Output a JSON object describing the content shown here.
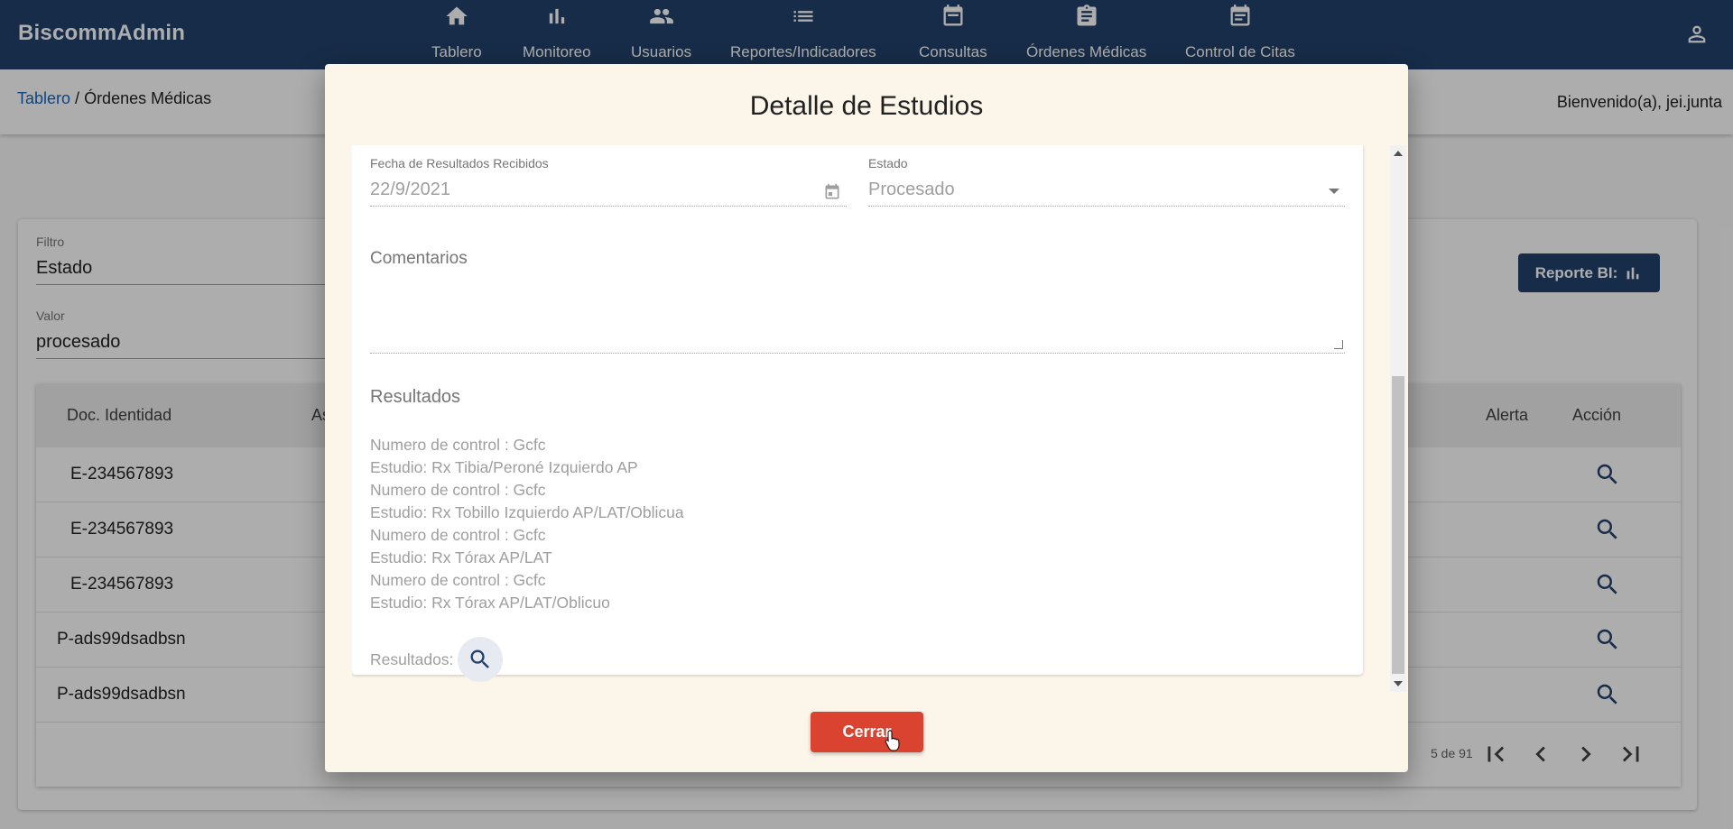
{
  "app": {
    "brand": "BiscommAdmin"
  },
  "nav": {
    "items": [
      {
        "label": "Tablero",
        "icon": "home-icon"
      },
      {
        "label": "Monitoreo",
        "icon": "bar-chart-icon"
      },
      {
        "label": "Usuarios",
        "icon": "people-icon"
      },
      {
        "label": "Reportes/Indicadores",
        "icon": "list-icon"
      },
      {
        "label": "Consultas",
        "icon": "calendar-icon"
      },
      {
        "label": "Órdenes Médicas",
        "icon": "clipboard-icon"
      },
      {
        "label": "Control de Citas",
        "icon": "calendar-icon"
      }
    ],
    "user_icon": "account-icon"
  },
  "breadcrumb": {
    "link": "Tablero",
    "separator": " / ",
    "current": "Órdenes Médicas"
  },
  "welcome": "Bienvenido(a), jei.junta",
  "filters": {
    "filter_label": "Filtro",
    "filter_value": "Estado",
    "value_label": "Valor",
    "value_value": "procesado"
  },
  "bi_button": {
    "label": "Reporte BI:",
    "icon": "bar-chart-icon"
  },
  "table": {
    "columns": [
      "Doc. Identidad",
      "As",
      "Alerta",
      "Acción"
    ],
    "rows": [
      {
        "doc": "E-234567893"
      },
      {
        "doc": "E-234567893"
      },
      {
        "doc": "E-234567893"
      },
      {
        "doc": "P-ads99dsadbsn"
      },
      {
        "doc": "P-ads99dsadbsn"
      }
    ],
    "range": "5 de 91"
  },
  "dialog": {
    "title": "Detalle de Estudios",
    "date_label": "Fecha de Resultados Recibidos",
    "date_value": "22/9/2021",
    "status_label": "Estado",
    "status_value": "Procesado",
    "comments_placeholder": "Comentarios",
    "results_heading": "Resultados",
    "results_lines": [
      "Numero de control : Gcfc",
      "Estudio: Rx Tibia/Peroné Izquierdo AP",
      "Numero de control : Gcfc",
      "Estudio: Rx Tobillo Izquierdo AP/LAT/Oblicua",
      "Numero de control : Gcfc",
      "Estudio: Rx Tórax AP/LAT",
      "Numero de control : Gcfc",
      "Estudio: Rx Tórax AP/LAT/Oblicuo"
    ],
    "results_footer": "Resultados:",
    "close_label": "Cerrar"
  },
  "colors": {
    "primary": "#22416b",
    "danger": "#d9432f",
    "dialog_bg": "#fcf5ea"
  }
}
